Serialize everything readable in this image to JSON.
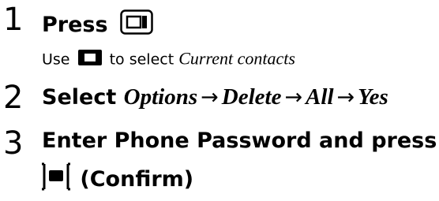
{
  "steps": [
    {
      "number": "1",
      "text": "Press",
      "key_icon": "side-menu-key-icon",
      "note_prefix": "Use",
      "note_icon": "navigation-key-icon",
      "note_middle": "to select",
      "note_item": "Current contacts"
    },
    {
      "number": "2",
      "text": "Select",
      "path": [
        "Options",
        "Delete",
        "All",
        "Yes"
      ],
      "arrow": "→"
    },
    {
      "number": "3",
      "line1": "Enter Phone Password and press",
      "key_icon": "center-select-key-icon",
      "line2": "(Confirm)"
    }
  ]
}
